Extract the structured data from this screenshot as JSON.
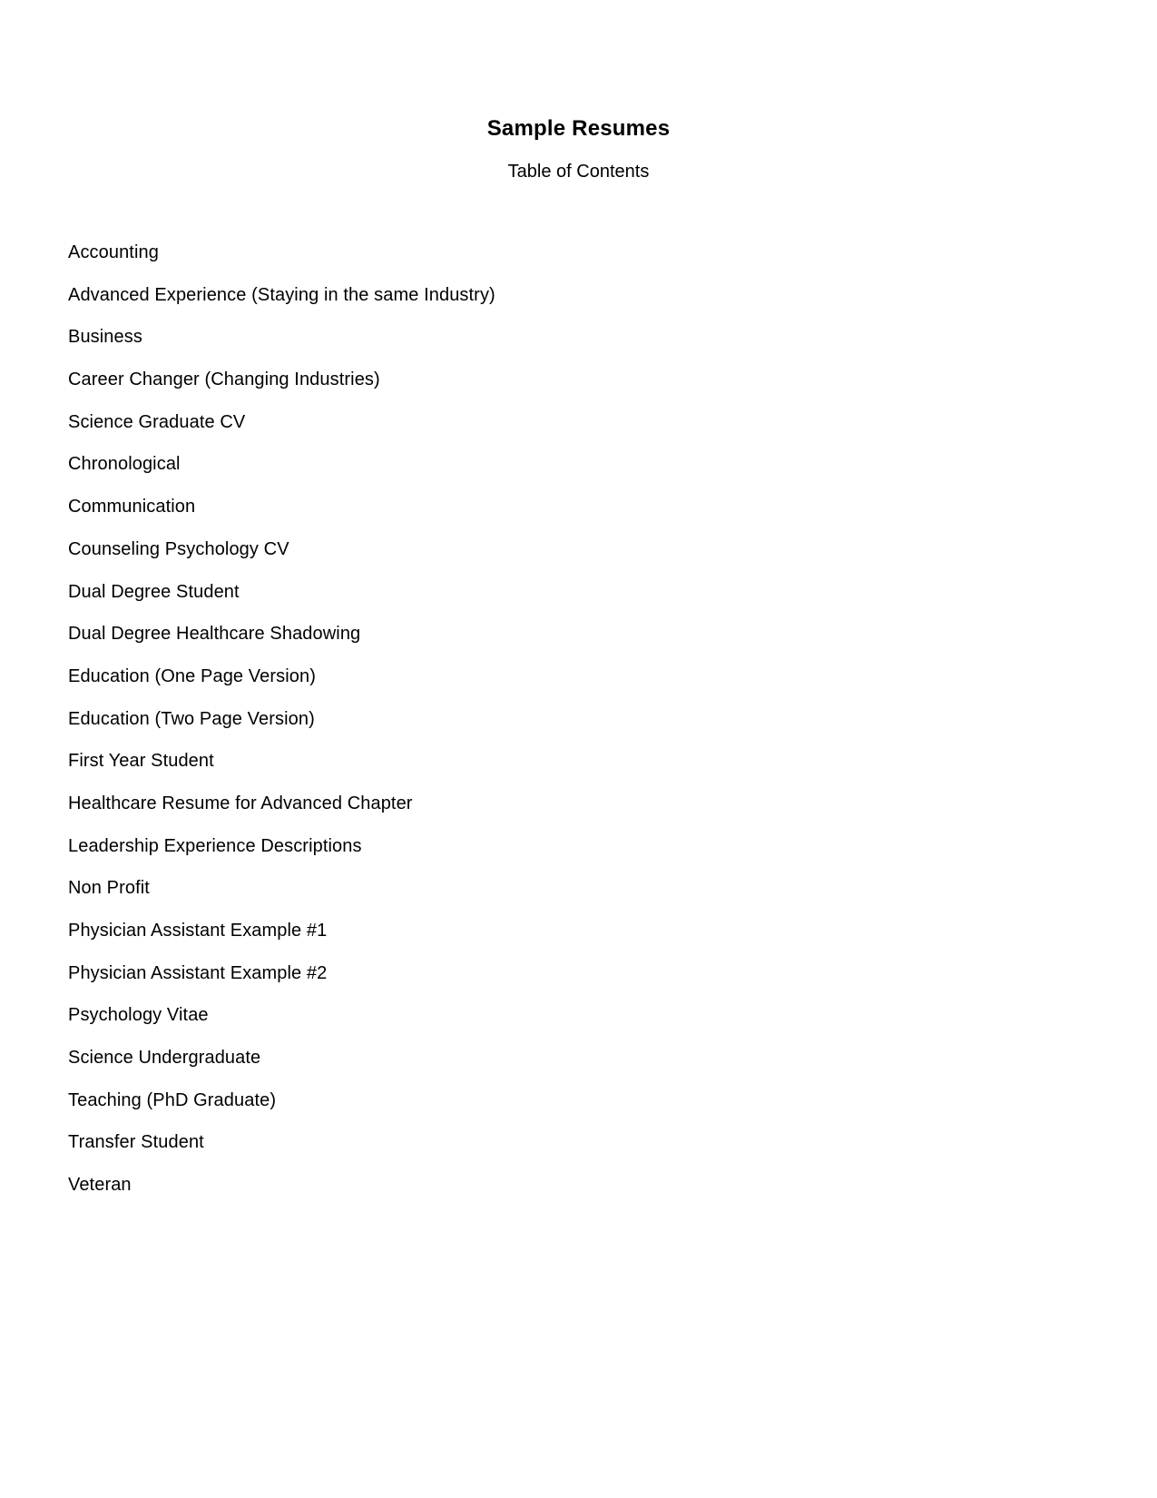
{
  "document": {
    "title": "Sample Resumes",
    "subtitle": "Table of Contents"
  },
  "toc": {
    "items": [
      "Accounting",
      "Advanced Experience (Staying in the same Industry)",
      "Business",
      "Career Changer (Changing Industries)",
      "Science Graduate CV",
      "Chronological",
      "Communication",
      "Counseling Psychology CV",
      "Dual Degree Student",
      "Dual Degree Healthcare Shadowing",
      "Education (One Page Version)",
      "Education (Two Page Version)",
      "First Year Student",
      "Healthcare Resume for Advanced Chapter",
      "Leadership Experience Descriptions",
      "Non Profit",
      "Physician Assistant Example #1",
      "Physician Assistant Example #2",
      "Psychology Vitae",
      "Science Undergraduate",
      "Teaching (PhD Graduate)",
      "Transfer Student",
      "Veteran"
    ]
  }
}
